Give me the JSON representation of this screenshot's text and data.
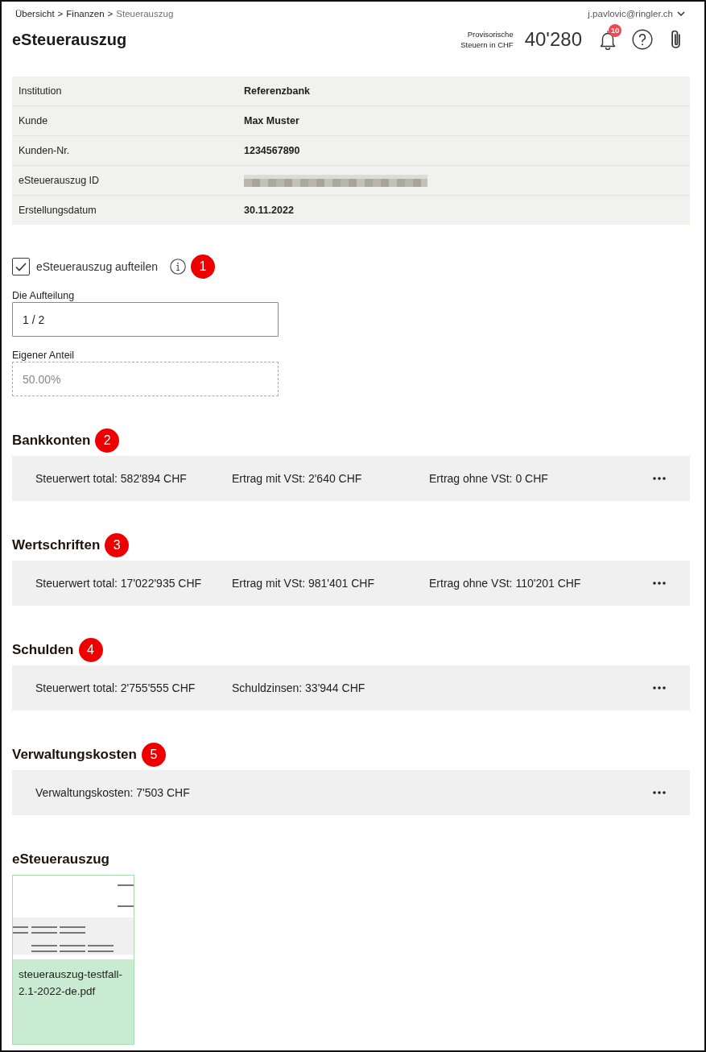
{
  "breadcrumb": {
    "separator": ">",
    "items": [
      {
        "label": "Übersicht",
        "current": false
      },
      {
        "label": "Finanzen",
        "current": false
      },
      {
        "label": "Steuerauszug",
        "current": true
      }
    ]
  },
  "user": {
    "email": "j.pavlovic@ringler.ch"
  },
  "header": {
    "title": "eSteuerauszug",
    "tax_label": "Provisorische Steuern in CHF",
    "tax_amount": "40'280",
    "notification_count": "10"
  },
  "info_table": [
    {
      "label": "Institution",
      "value": "Referenzbank",
      "redacted": false
    },
    {
      "label": "Kunde",
      "value": "Max Muster",
      "redacted": false
    },
    {
      "label": "Kunden-Nr.",
      "value": "1234567890",
      "redacted": false
    },
    {
      "label": "eSteuerauszug ID",
      "redacted": true
    },
    {
      "label": "Erstellungsdatum",
      "value": "30.11.2022",
      "redacted": false
    }
  ],
  "split": {
    "label": "eSteuerauszug aufteilen",
    "checked": true,
    "marker": "1"
  },
  "fields": [
    {
      "label": "Die Aufteilung",
      "value": "1 / 2",
      "disabled": false
    },
    {
      "label": "Eigener Anteil",
      "value": "50.00%",
      "disabled": true
    }
  ],
  "sections": [
    {
      "title": "Bankkonten",
      "marker": "2",
      "items": [
        "Steuerwert total: 582'894 CHF",
        "Ertrag mit VSt: 2'640 CHF",
        "Ertrag ohne VSt: 0 CHF"
      ]
    },
    {
      "title": "Wertschriften",
      "marker": "3",
      "items": [
        "Steuerwert total: 17'022'935 CHF",
        "Ertrag mit VSt: 981'401 CHF",
        "Ertrag ohne VSt: 110'201 CHF"
      ]
    },
    {
      "title": "Schulden",
      "marker": "4",
      "items": [
        "Steuerwert total: 2'755'555 CHF",
        "Schuldzinsen: 33'944 CHF"
      ]
    },
    {
      "title": "Verwaltungskosten",
      "marker": "5",
      "items": [
        "Verwaltungskosten: 7'503 CHF"
      ]
    }
  ],
  "documents": {
    "title": "eSteuerauszug",
    "files": [
      {
        "name": "steuerauszug-testfall-2.1-2022-de.pdf"
      }
    ]
  }
}
